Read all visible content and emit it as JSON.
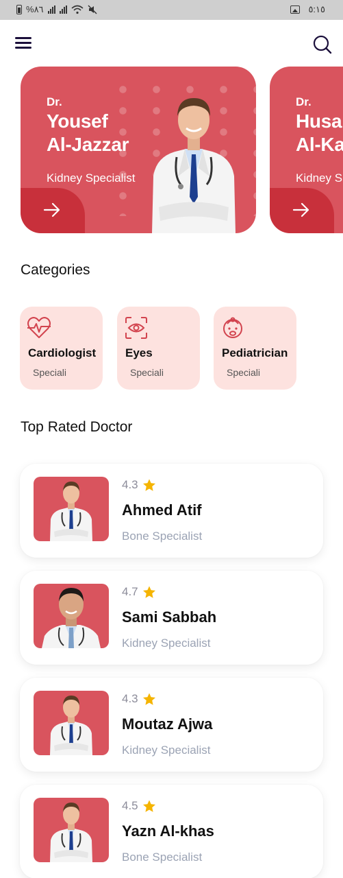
{
  "status_bar": {
    "battery_text": "%٨٦",
    "time": "٥:١٥"
  },
  "header": {
    "menu_icon": "hamburger-menu-icon",
    "search_icon": "search-icon"
  },
  "featured_doctors": [
    {
      "prefix": "Dr.",
      "name_line1": "Yousef",
      "name_line2": "Al-Jazzar",
      "specialty": "Kidney Specialist"
    },
    {
      "prefix": "Dr.",
      "name_line1": "Husa",
      "name_line2": "Al-Ka",
      "specialty": "Kidney S"
    }
  ],
  "categories": {
    "title": "Categories",
    "items": [
      {
        "name": "Cardiologist",
        "sub": "Speciali",
        "icon": "heart-pulse-icon"
      },
      {
        "name": "Eyes",
        "sub": "Speciali",
        "icon": "eye-scan-icon"
      },
      {
        "name": "Pediatrician",
        "sub": "Speciali",
        "icon": "baby-face-icon"
      }
    ]
  },
  "top_rated": {
    "title": "Top Rated Doctor",
    "doctors": [
      {
        "rating": "4.3",
        "name": "Ahmed Atif",
        "specialty": "Bone Specialist"
      },
      {
        "rating": "4.7",
        "name": "Sami Sabbah",
        "specialty": "Kidney Specialist"
      },
      {
        "rating": "4.3",
        "name": "Moutaz Ajwa",
        "specialty": "Kidney Specialist"
      },
      {
        "rating": "4.5",
        "name": "Yazn Al-khas",
        "specialty": "Bone Specialist"
      }
    ]
  },
  "colors": {
    "accent": "#d9545e",
    "accent_dark": "#c8303b",
    "category_bg": "#fde2df",
    "star": "#f5b400"
  }
}
